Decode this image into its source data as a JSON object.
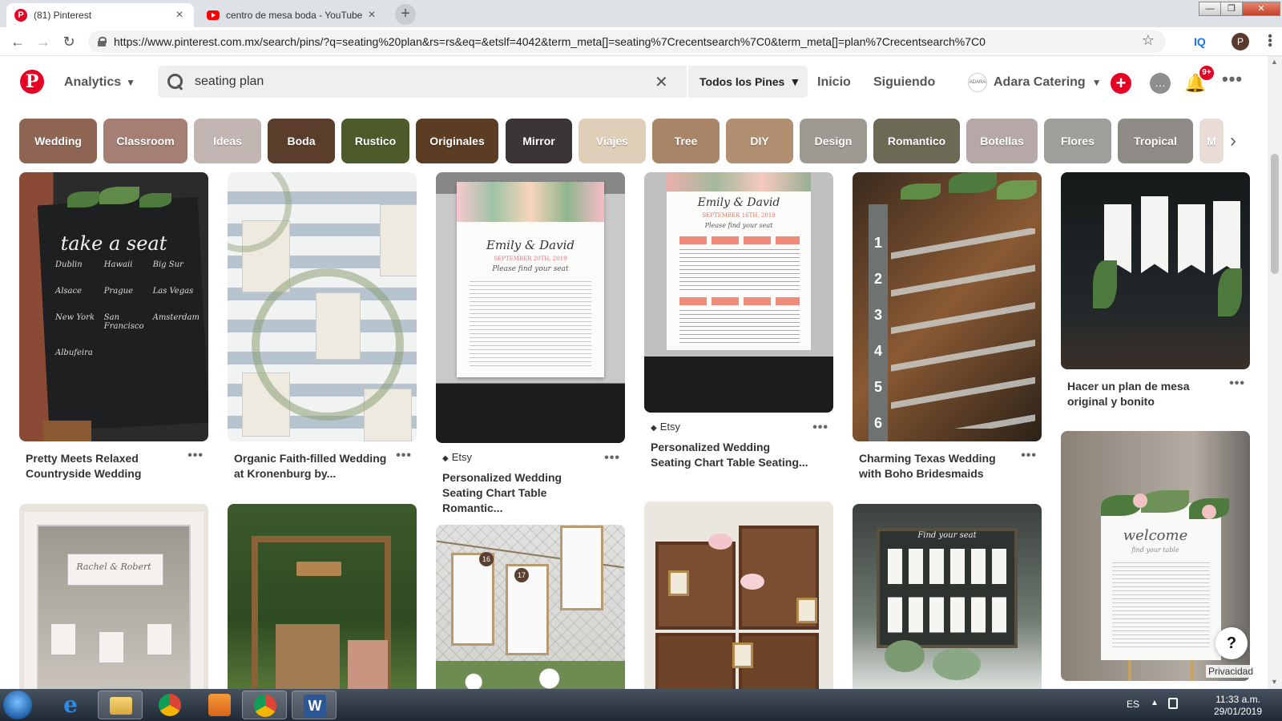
{
  "browser": {
    "tabs": [
      {
        "title": "(81) Pinterest",
        "icon": "pinterest-icon"
      },
      {
        "title": "centro de mesa boda - YouTube",
        "icon": "youtube-icon"
      }
    ],
    "url": "https://www.pinterest.com.mx/search/pins/?q=seating%20plan&rs=rs&eq=&etslf=4042&term_meta[]=seating%7Crecentsearch%7C0&term_meta[]=plan%7Crecentsearch%7C0",
    "extension_label": "IQ",
    "profile_initial": "P"
  },
  "header": {
    "logo": "P",
    "analytics_label": "Analytics",
    "search_value": "seating plan",
    "scope_label": "Todos los Pines",
    "nav": [
      {
        "label": "Inicio"
      },
      {
        "label": "Siguiendo"
      }
    ],
    "account_name": "Adara Catering",
    "account_avatar": "ADARA",
    "notifications_badge": "9+"
  },
  "guides": [
    {
      "label": "Wedding",
      "color": "#8f6553"
    },
    {
      "label": "Classroom",
      "color": "#a57f73"
    },
    {
      "label": "Ideas",
      "color": "#c2b6b2"
    },
    {
      "label": "Boda",
      "color": "#5a3d2a"
    },
    {
      "label": "Rustico",
      "color": "#4d5a2a"
    },
    {
      "label": "Originales",
      "color": "#5b3d23"
    },
    {
      "label": "Mirror",
      "color": "#3c3535"
    },
    {
      "label": "Viajes",
      "color": "#dfcfb8"
    },
    {
      "label": "Tree",
      "color": "#a98567"
    },
    {
      "label": "DIY",
      "color": "#b08f70"
    },
    {
      "label": "Design",
      "color": "#9e9a92"
    },
    {
      "label": "Romantico",
      "color": "#6c6a55"
    },
    {
      "label": "Botellas",
      "color": "#b5a8a6"
    },
    {
      "label": "Flores",
      "color": "#a09e9a"
    },
    {
      "label": "Tropical",
      "color": "#8f8c88"
    },
    {
      "label": "M",
      "color": "#e9dcd6"
    }
  ],
  "pins": [
    {
      "title": "Pretty Meets Relaxed Countryside Wedding",
      "source": ""
    },
    {
      "title": "Organic Faith-filled Wedding at Kronenburg by...",
      "source": ""
    },
    {
      "title": "Personalized Wedding Seating Chart Table Romantic...",
      "source": "Etsy"
    },
    {
      "title": "Personalized Wedding Seating Chart Table Seating...",
      "source": "Etsy"
    },
    {
      "title": "Charming Texas Wedding with Boho Bridesmaids",
      "source": ""
    },
    {
      "title": "Hacer un plan de mesa original y bonito",
      "source": ""
    }
  ],
  "pin_art": {
    "chalkboard_heading": "take a seat",
    "chalk_tables": [
      "Dublin",
      "Hawaii",
      "Big Sur",
      "Alsace",
      "Prague",
      "Las Vegas",
      "New York",
      "San Francisco",
      "Amsterdam",
      "Albufeira"
    ],
    "poster_names": "Emily & David",
    "poster_date_a": "SEPTEMBER 20TH, 2019",
    "poster_date_b": "SEPTEMBER 16TH, 2019",
    "poster_sub": "Please find your seat",
    "mirror_names": "Rachel & Robert",
    "rustic_sign": "Find your seat",
    "welcome_sign": "welcome",
    "welcome_sub": "find your table",
    "tag_numbers": [
      "16",
      "17"
    ],
    "ladder_numbers": [
      "1",
      "2",
      "3",
      "4",
      "5",
      "6"
    ]
  },
  "help_label": "?",
  "privacy_label": "Privacidad",
  "taskbar": {
    "language": "ES",
    "time": "11:33 a.m.",
    "date": "29/01/2019"
  },
  "colors": {
    "pinterest_red": "#e60023",
    "link_blue": "#1a73e8"
  }
}
